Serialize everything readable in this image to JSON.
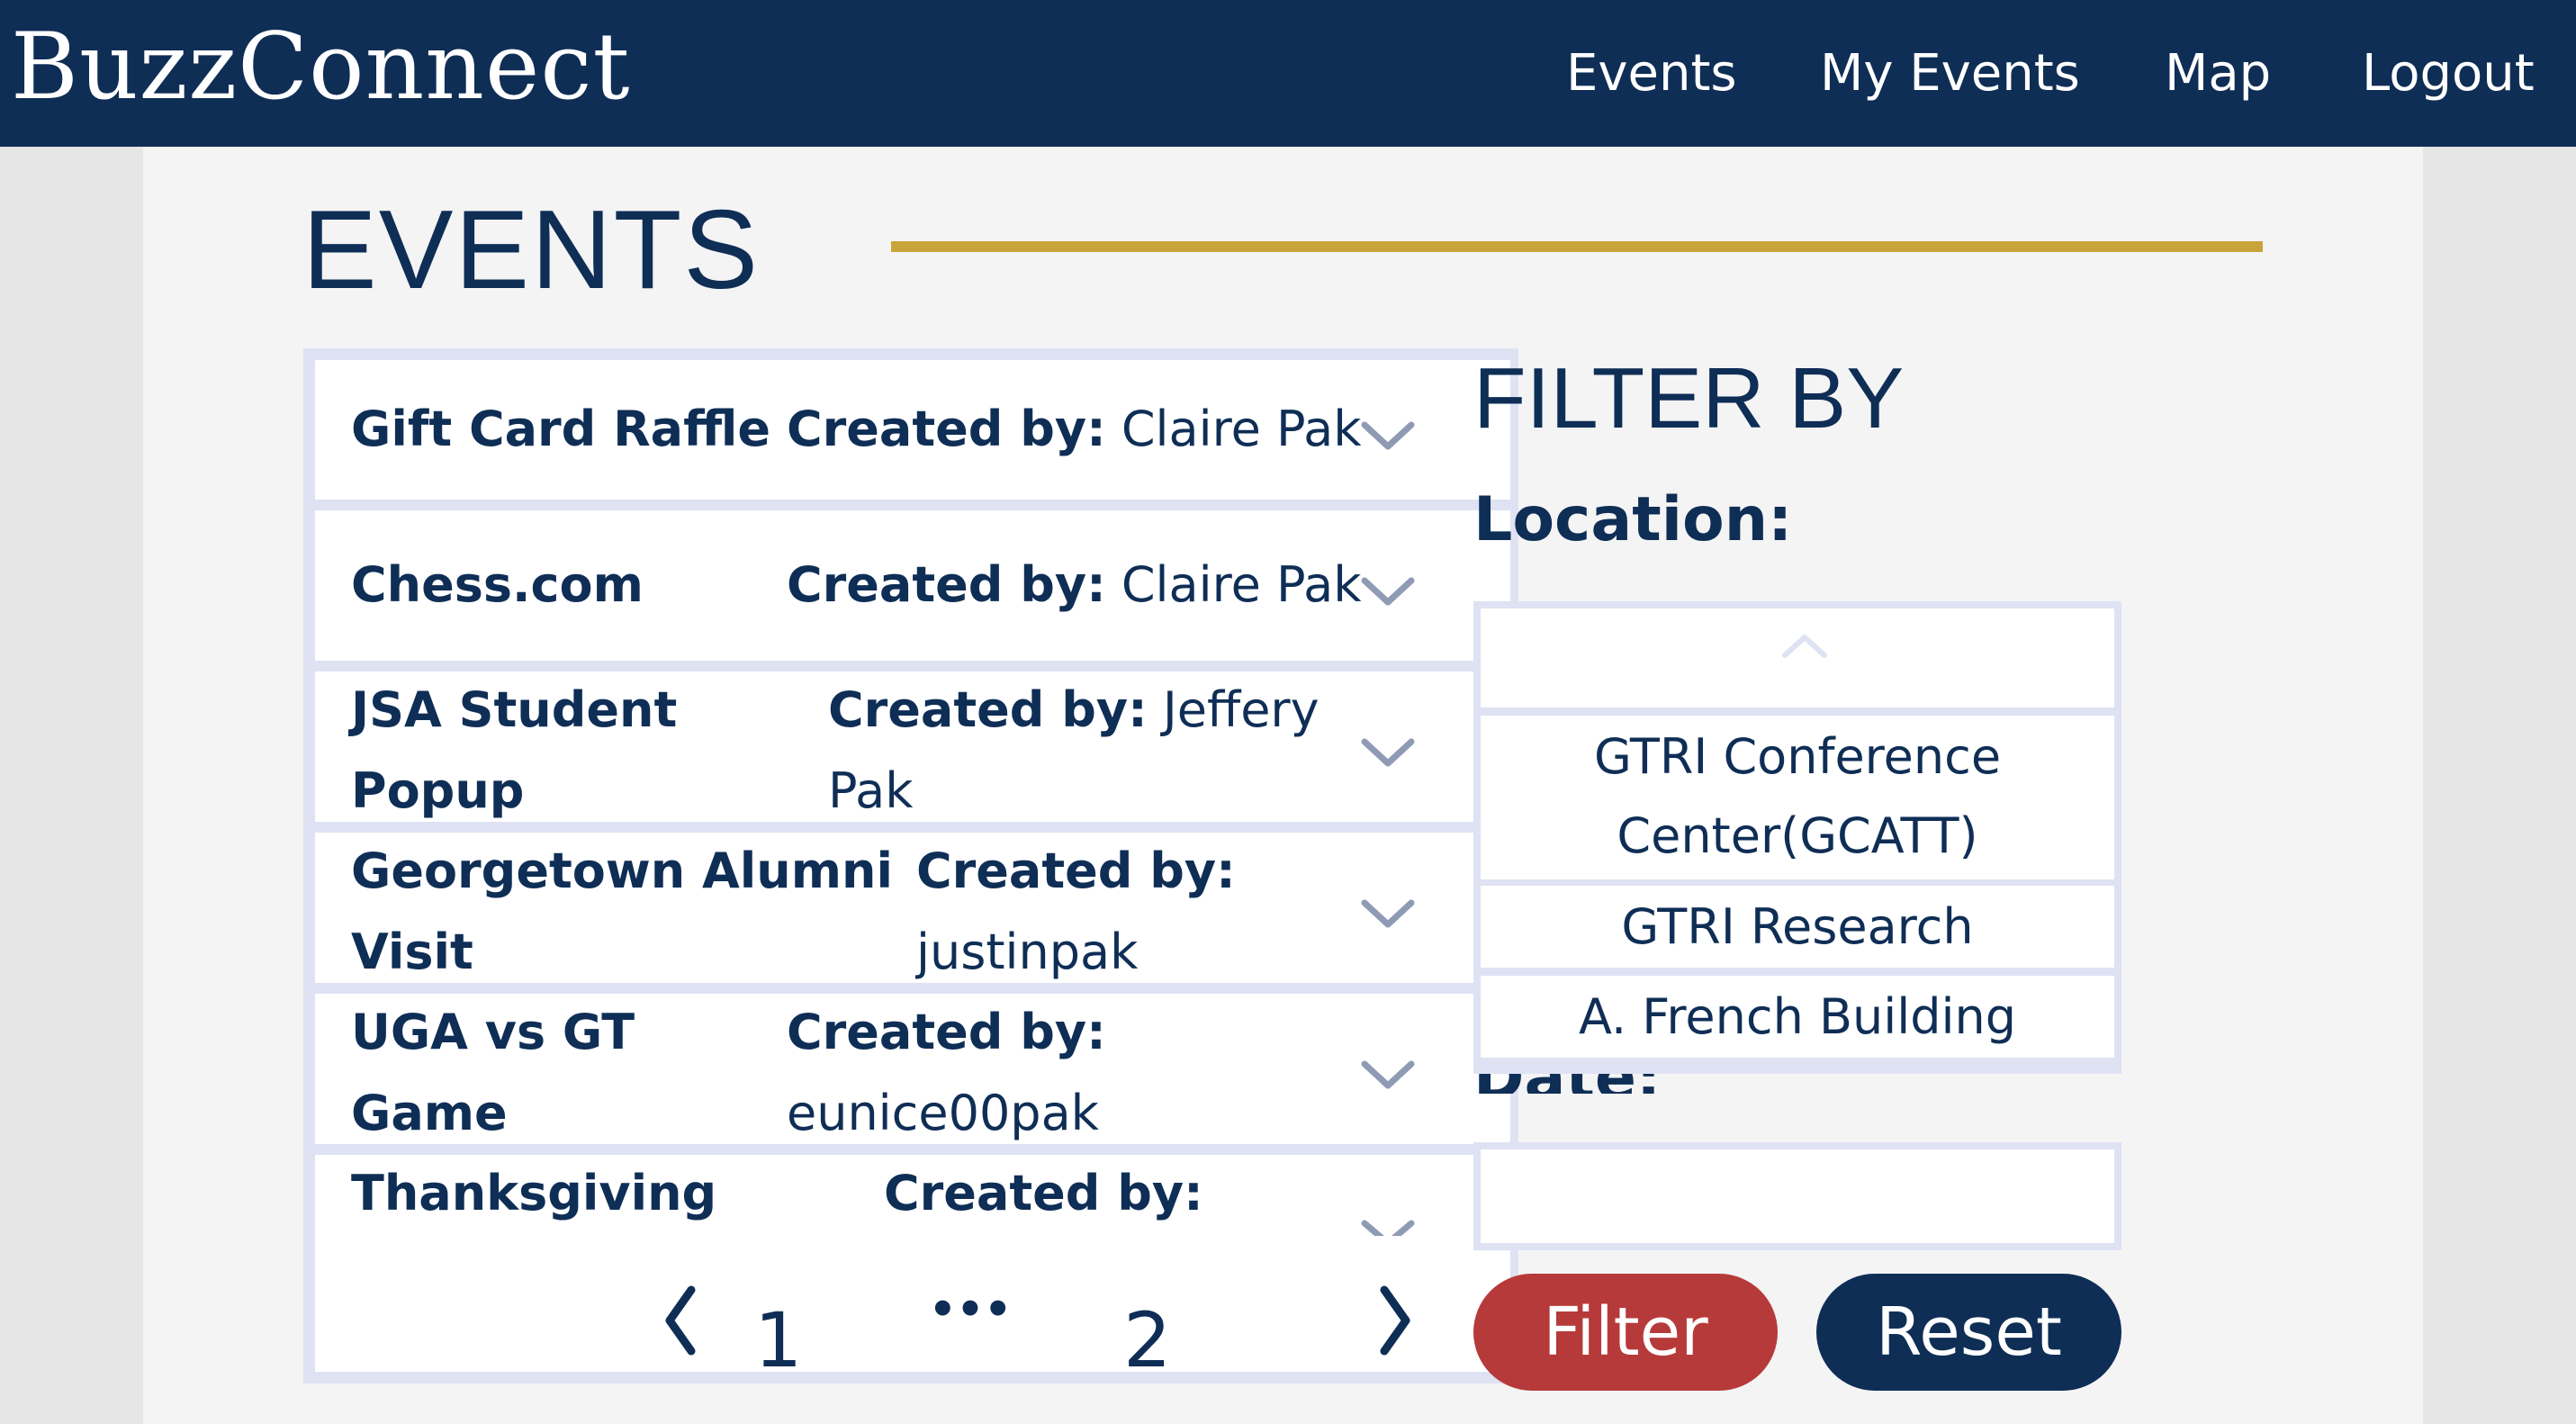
{
  "app": {
    "brand": "BuzzConnect"
  },
  "nav": {
    "events": "Events",
    "my_events": "My Events",
    "map": "Map",
    "logout": "Logout"
  },
  "page": {
    "title": "EVENTS"
  },
  "events": [
    {
      "title_lines": [
        "Gift Card Raffle"
      ],
      "created_label": "Created by:",
      "creator": "Claire Pak"
    },
    {
      "title_lines": [
        "Chess.com"
      ],
      "created_label": "Created by:",
      "creator": "Claire Pak"
    },
    {
      "title_lines": [
        "JSA Student",
        "Popup"
      ],
      "created_label": "Created by:",
      "creator_line1": "Jeffery",
      "creator_line2": "Pak"
    },
    {
      "title_lines": [
        "Georgetown Alumni",
        "Visit"
      ],
      "created_label": "Created by:",
      "creator": "justinpak"
    },
    {
      "title_lines": [
        "UGA vs GT",
        "Game"
      ],
      "created_label": "Created by:",
      "creator": "eunice00pak"
    },
    {
      "title_lines": [
        "Thanksgiving"
      ],
      "created_label": "Created by:",
      "creator": ""
    }
  ],
  "pagination": {
    "page1": "1",
    "ellipsis": "•••",
    "page2": "2"
  },
  "filter": {
    "title": "FILTER BY",
    "location_label": "Location:",
    "location_options": [
      "GTRI Conference Center(GCATT)",
      "GTRI Research",
      "A. French Building"
    ],
    "date_label": "Date:",
    "date_value": "",
    "filter_button": "Filter",
    "reset_button": "Reset"
  },
  "colors": {
    "navy": "#0f2e56",
    "gold": "#c9a43a",
    "filter_red": "#b73a3a",
    "card_border": "#dfe2f3",
    "chevron": "#8f9bb5"
  }
}
